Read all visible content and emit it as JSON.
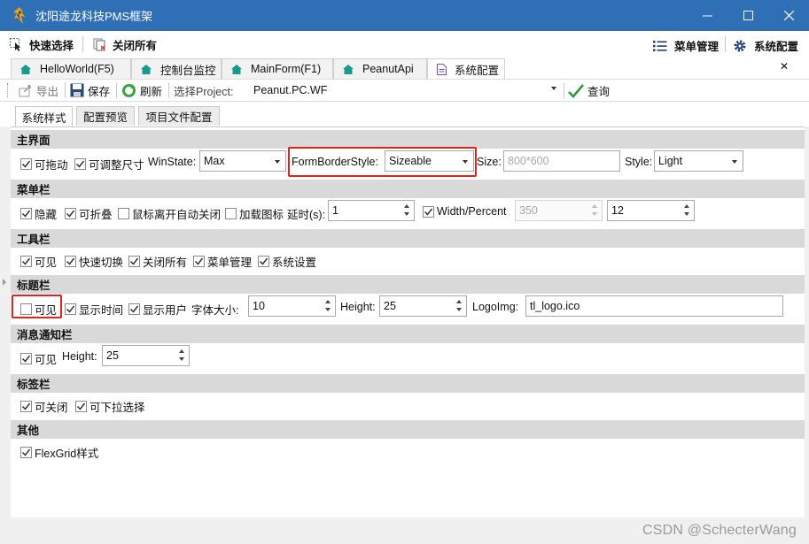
{
  "window": {
    "title": "沈阳途龙科技PMS框架",
    "minimize_glyph": "—",
    "maximize_glyph": "☐",
    "close_glyph": "✕"
  },
  "quickbar": {
    "quick_switch": "快速选择",
    "close_all": "关闭所有",
    "menu_manage": "菜单管理",
    "system_settings": "系统配置"
  },
  "tabs": [
    {
      "label": "HelloWorld(F5)"
    },
    {
      "label": "控制台监控"
    },
    {
      "label": "MainForm(F1)"
    },
    {
      "label": "PeanutApi"
    },
    {
      "label": "系统配置"
    }
  ],
  "tabs_close_glyph": "✕",
  "toolbar": {
    "export": "导出",
    "save": "保存",
    "refresh": "刷新",
    "project_label": "选择Project:",
    "project_value": "Peanut.PC.WF",
    "query": "查询"
  },
  "subtabs": [
    {
      "label": "系统样式"
    },
    {
      "label": "配置预览"
    },
    {
      "label": "项目文件配置"
    }
  ],
  "sections": {
    "main": {
      "title": "主界面",
      "draggable": "可拖动",
      "resizable": "可调整尺寸",
      "winstate_label": "WinState:",
      "winstate_value": "Max",
      "border_label": "FormBorderStyle:",
      "border_value": "Sizeable",
      "size_label": "Size:",
      "size_placeholder": "800*600",
      "style_label": "Style:",
      "style_value": "Light"
    },
    "menu": {
      "title": "菜单栏",
      "hide": "隐藏",
      "collapsible": "可折叠",
      "auto_close": "鼠标离开自动关闭",
      "load_icon": "加载图标",
      "delay_label": "延时(s):",
      "delay_value": "1",
      "width_percent": "Width/Percent",
      "width_value": "350",
      "percent_value": "12"
    },
    "tool": {
      "title": "工具栏",
      "visible": "可见",
      "quick_switch": "快速切换",
      "close_all": "关闭所有",
      "menu_manage": "菜单管理",
      "sys_settings": "系统设置"
    },
    "titlebar": {
      "title": "标题栏",
      "visible": "可见",
      "show_time": "显示时间",
      "show_user": "显示用户",
      "font_size_label": "字体大小:",
      "font_size_value": "10",
      "height_label": "Height:",
      "height_value": "25",
      "logo_label": "LogoImg:",
      "logo_value": "tl_logo.ico"
    },
    "notify": {
      "title": "消息通知栏",
      "visible": "可见",
      "height_label": "Height:",
      "height_value": "25"
    },
    "tagbar": {
      "title": "标签栏",
      "closable": "可关闭",
      "dropdown": "可下拉选择"
    },
    "other": {
      "title": "其他",
      "flexgrid": "FlexGrid样式"
    }
  },
  "colors": {
    "titlebar": "#2f6fb6",
    "section_header": "#d9d9d9",
    "highlight_box": "#e2231a",
    "home_icon": "#1a9a8a"
  },
  "watermark": "CSDN @SchecterWang"
}
